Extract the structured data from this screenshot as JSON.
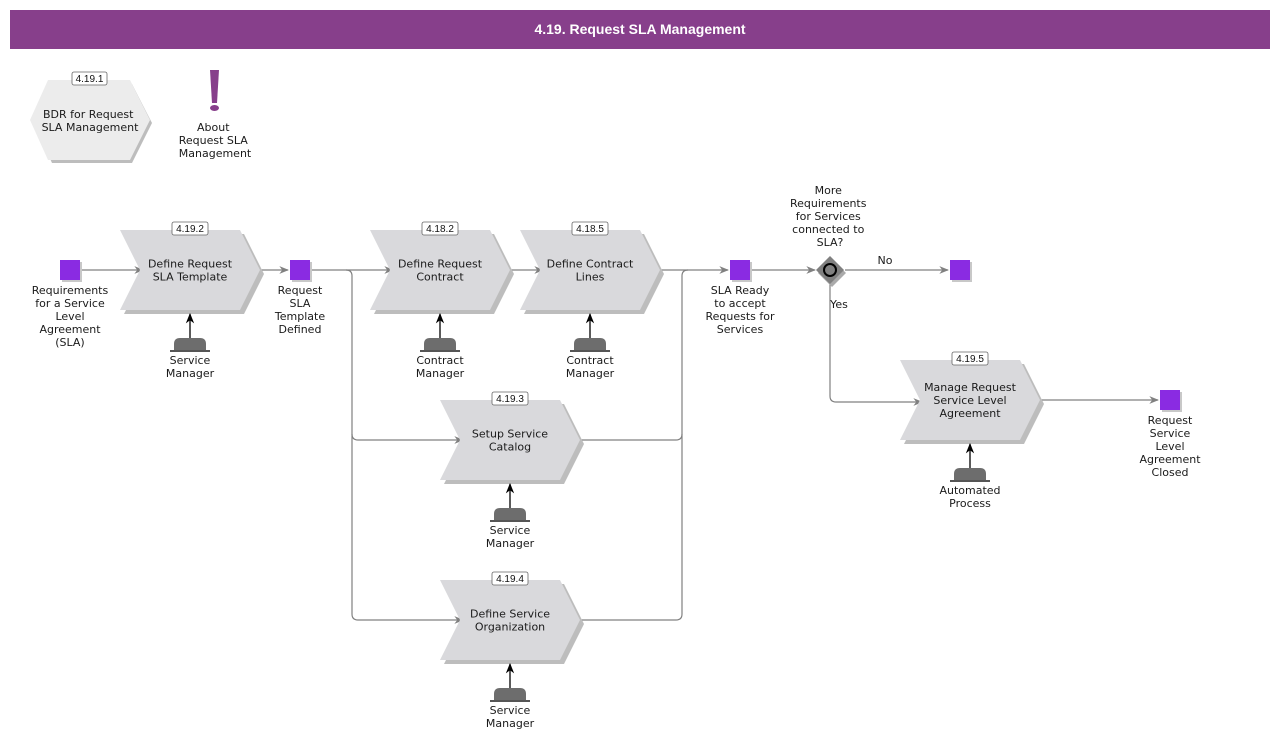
{
  "header": {
    "title": "4.19. Request SLA Management"
  },
  "colors": {
    "header_bg": "#873f8b",
    "event": "#8a2be2",
    "task": "#d9d9dc",
    "connector": "#808080",
    "about_icon": "#873f8b"
  },
  "top_items": {
    "bdr": {
      "id": "4.19.1",
      "label": [
        "BDR for Request",
        "SLA Management"
      ]
    },
    "about": {
      "icon": "exclamation-icon",
      "label": [
        "About",
        "Request SLA",
        "Management"
      ]
    }
  },
  "tasks": [
    {
      "key": "t1",
      "id": "4.19.2",
      "label": [
        "Define Request",
        "SLA Template"
      ],
      "role": [
        "Service",
        "Manager"
      ]
    },
    {
      "key": "t2",
      "id": "4.18.2",
      "label": [
        "Define Request",
        "Contract"
      ],
      "role": [
        "Contract",
        "Manager"
      ]
    },
    {
      "key": "t3",
      "id": "4.18.5",
      "label": [
        "Define Contract",
        "Lines"
      ],
      "role": [
        "Contract",
        "Manager"
      ]
    },
    {
      "key": "t4",
      "id": "4.19.3",
      "label": [
        "Setup Service",
        "Catalog"
      ],
      "role": [
        "Service",
        "Manager"
      ]
    },
    {
      "key": "t5",
      "id": "4.19.4",
      "label": [
        "Define Service",
        "Organization"
      ],
      "role": [
        "Service",
        "Manager"
      ]
    },
    {
      "key": "t6",
      "id": "4.19.5",
      "label": [
        "Manage Request",
        "Service Level",
        "Agreement"
      ],
      "role": [
        "Automated",
        "Process"
      ]
    }
  ],
  "events": [
    {
      "key": "e1",
      "label": [
        "Requirements",
        "for a Service",
        "Level",
        "Agreement",
        "(SLA)"
      ]
    },
    {
      "key": "e2",
      "label": [
        "Request",
        "SLA",
        "Template",
        "Defined"
      ]
    },
    {
      "key": "e3",
      "label": [
        "SLA Ready",
        "to accept",
        "Requests for",
        "Services"
      ]
    },
    {
      "key": "e4",
      "label": []
    },
    {
      "key": "e5",
      "label": [
        "Request",
        "Service",
        "Level",
        "Agreement",
        "Closed"
      ]
    }
  ],
  "gateway": {
    "type": "exclusive-or",
    "question": [
      "More",
      "Requirements",
      "for Services",
      "connected to",
      "SLA?"
    ],
    "branch_no": "No",
    "branch_yes": "Yes"
  }
}
